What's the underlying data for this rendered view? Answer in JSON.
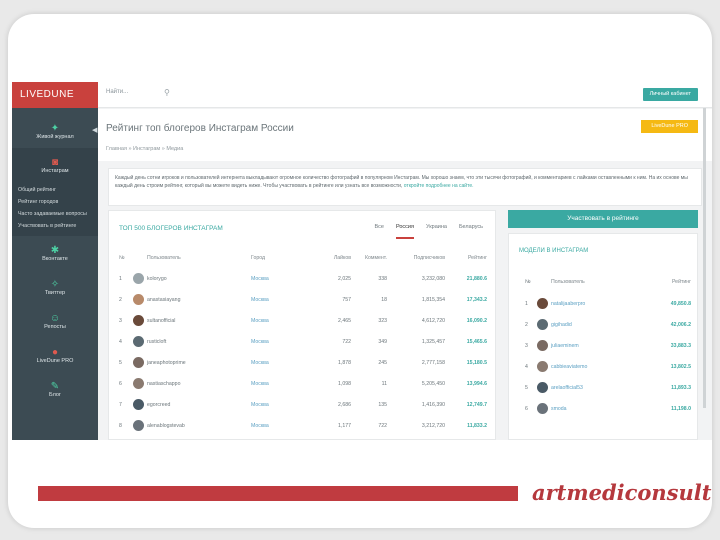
{
  "app": {
    "logo": "LIVEDUNE"
  },
  "search": {
    "placeholder": "Найти..."
  },
  "topbar": {
    "button_label": "Личный кабинет"
  },
  "page": {
    "title": "Рейтинг топ блогеров Инстаграм России",
    "breadcrumb": "Главная » Инстаграм » Медиа",
    "yellow_button": "LiveDune PRO"
  },
  "info": {
    "text": "Каждый день сотни игроков и пользователей интернета выкладывают огромное количество фотографий в популярном Инстаграм. Мы хорошо знаем, что эти тысячи фотографий, и комментариев с лайками оставленными к ним. На их основе мы каждый день строим рейтинг, который вы можете видеть ниже. Чтобы участвовать в рейтинге или узнать все возможности,",
    "link": "откройте подробнее на сайте."
  },
  "sidebar": {
    "items": [
      {
        "label": "Живой журнал",
        "icon": "bird-icon"
      },
      {
        "label": "Инстаграм",
        "icon": "instagram-icon"
      },
      {
        "label": "Вконтакте",
        "icon": "vk-icon"
      },
      {
        "label": "Твиттер",
        "icon": "twitter-icon"
      },
      {
        "label": "Репосты",
        "icon": "smile-icon"
      },
      {
        "label": "LiveDune PRO",
        "icon": "pro-icon"
      },
      {
        "label": "Блог",
        "icon": "blog-icon"
      }
    ],
    "sub": [
      "Общий рейтинг",
      "Рейтинг городов",
      "Часто задаваемые вопросы",
      "Участвовать в рейтинге"
    ]
  },
  "table": {
    "title": "ТОП 500 БЛОГЕРОВ ИНСТАГРАМ",
    "tabs": [
      "Все",
      "Россия",
      "Украина",
      "Беларусь"
    ],
    "active_tab": "Россия",
    "headers": {
      "n": "№",
      "user": "Пользователь",
      "city": "Город",
      "likes": "Лайков",
      "comments": "Коммент.",
      "subs": "Подписчиков",
      "rating": "Рейтинг"
    },
    "rows": [
      {
        "n": "1",
        "user": "kolorygo",
        "city": "Москва",
        "likes": "2,025",
        "comments": "338",
        "subs": "3,232,080",
        "rating": "21,880.6"
      },
      {
        "n": "2",
        "user": "anastasiayang",
        "city": "Москва",
        "likes": "757",
        "comments": "18",
        "subs": "1,815,354",
        "rating": "17,343.2"
      },
      {
        "n": "3",
        "user": "sultanofficial",
        "city": "Москва",
        "likes": "2,465",
        "comments": "323",
        "subs": "4,612,720",
        "rating": "16,090.2"
      },
      {
        "n": "4",
        "user": "rusticloft",
        "city": "Москва",
        "likes": "722",
        "comments": "349",
        "subs": "1,325,457",
        "rating": "15,465.6"
      },
      {
        "n": "5",
        "user": "janeaphotoprime",
        "city": "Москва",
        "likes": "1,878",
        "comments": "245",
        "subs": "2,777,158",
        "rating": "15,180.5"
      },
      {
        "n": "6",
        "user": "nastiaschappo",
        "city": "Москва",
        "likes": "1,098",
        "comments": "11",
        "subs": "5,205,450",
        "rating": "13,994.6"
      },
      {
        "n": "7",
        "user": "egorcreed",
        "city": "Москва",
        "likes": "2,686",
        "comments": "135",
        "subs": "1,416,390",
        "rating": "12,749.7"
      },
      {
        "n": "8",
        "user": "alenablogstevab",
        "city": "Москва",
        "likes": "1,177",
        "comments": "722",
        "subs": "3,212,720",
        "rating": "11,833.2"
      }
    ]
  },
  "right": {
    "participate_button": "Участвовать в рейтинге",
    "models_title": "МОДЕЛИ В ИНСТАГРАМ",
    "headers": {
      "n": "№",
      "user": "Пользователь",
      "rating": "Рейтинг"
    },
    "rows": [
      {
        "n": "1",
        "user": "natalijaaberpro",
        "rating": "49,850.8"
      },
      {
        "n": "2",
        "user": "gigihadid",
        "rating": "42,006.2"
      },
      {
        "n": "3",
        "user": "juliaeminem",
        "rating": "33,883.3"
      },
      {
        "n": "4",
        "user": "cabbieaviatemo",
        "rating": "13,802.5"
      },
      {
        "n": "5",
        "user": "arelaofficial53",
        "rating": "11,893.3"
      },
      {
        "n": "6",
        "user": "smoda",
        "rating": "11,198.0"
      }
    ]
  },
  "footer": {
    "brand": "artmediconsult.ru"
  },
  "colors": {
    "accent": "#3aa9a2",
    "brand_red": "#c9413d",
    "yellow": "#f5b913",
    "sidebar": "#3c4b53"
  }
}
